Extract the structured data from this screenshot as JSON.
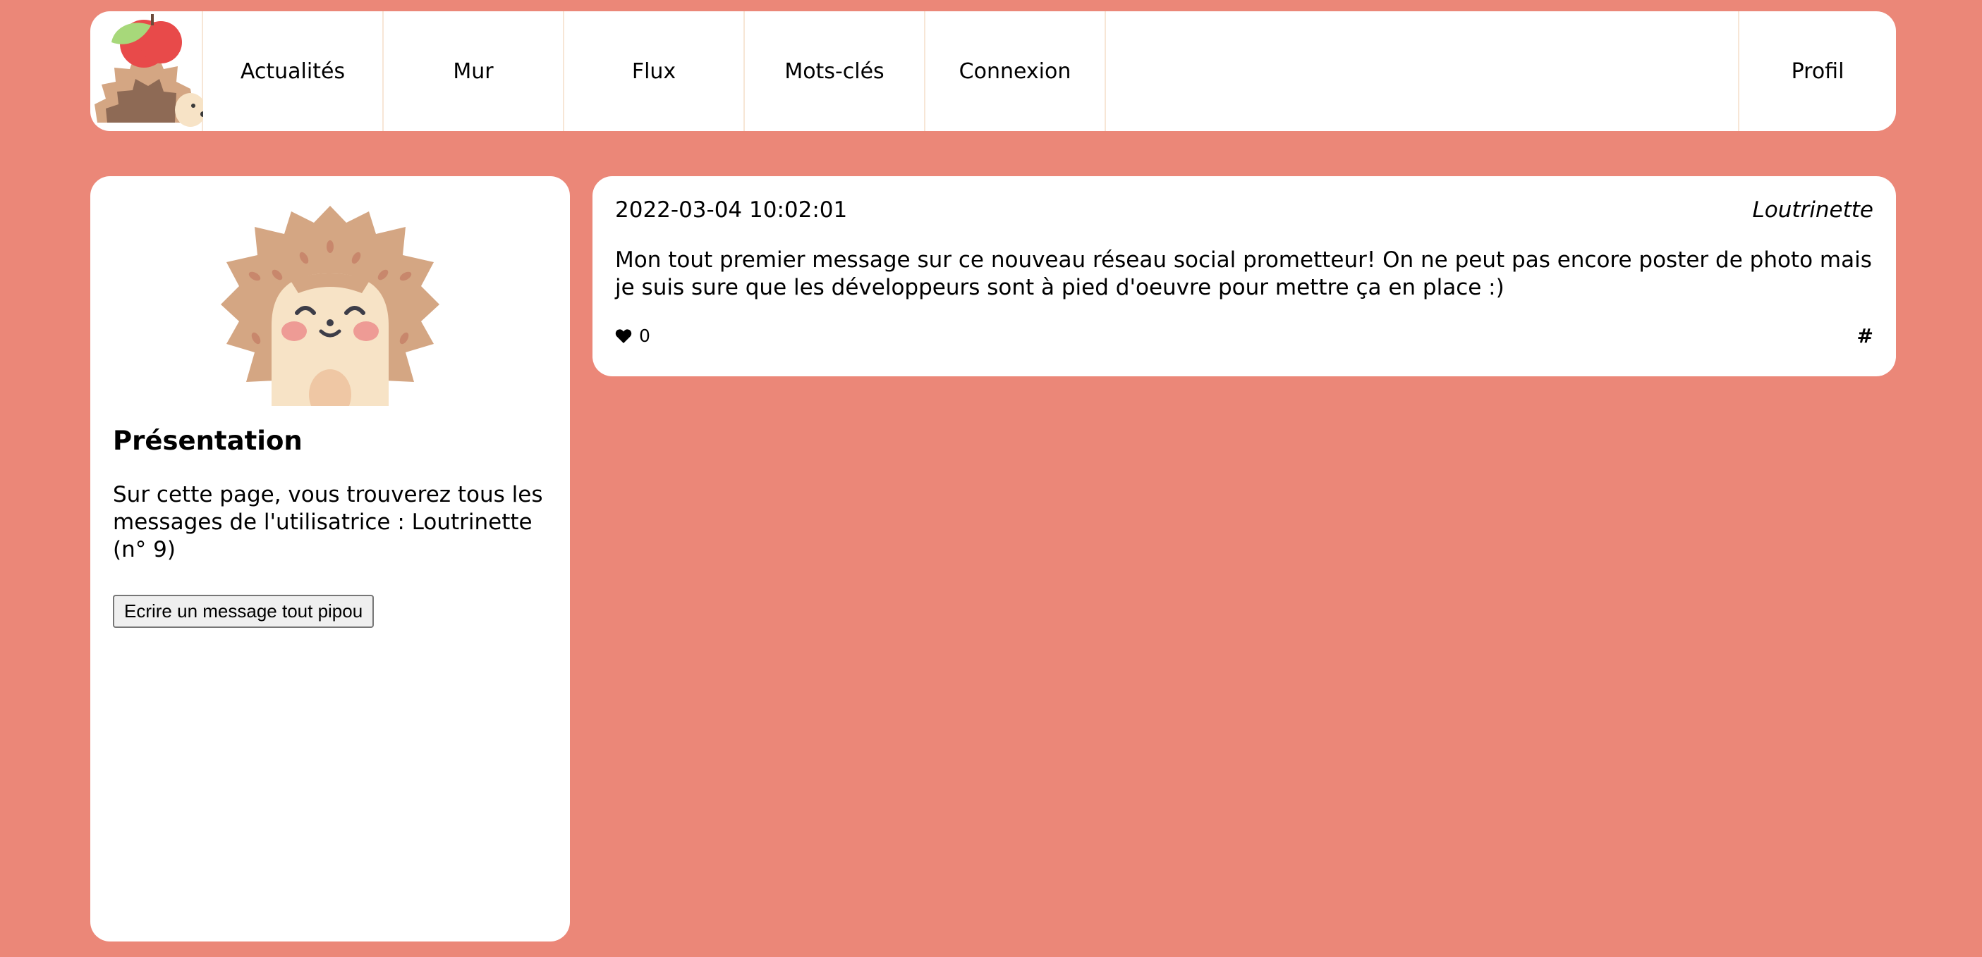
{
  "nav": {
    "items": [
      {
        "label": "Actualités"
      },
      {
        "label": "Mur"
      },
      {
        "label": "Flux"
      },
      {
        "label": "Mots-clés"
      },
      {
        "label": "Connexion"
      }
    ],
    "profile_label": "Profil"
  },
  "sidebar": {
    "title": "Présentation",
    "text": "Sur cette page, vous trouverez tous les messages de l'utilisatrice : Loutrinette (n° 9)",
    "button_label": "Ecrire un message tout pipou"
  },
  "post": {
    "date": "2022-03-04 10:02:01",
    "author": "Loutrinette",
    "content": "Mon tout premier message sur ce nouveau réseau social prometteur! On ne peut pas encore poster de photo mais je suis sure que les développeurs sont à pied d'oeuvre pour mettre ça en place :)",
    "likes": "0",
    "tag_symbol": "#"
  },
  "colors": {
    "background": "#eb8778",
    "card": "#ffffff",
    "hedgehog_spikes": "#d4a683",
    "hedgehog_face": "#f7e3c6",
    "cheeks": "#ee9b95",
    "apple": "#e84a4a"
  },
  "icons": {
    "logo": "hedgehog-with-apple-logo",
    "avatar": "hedgehog-avatar",
    "like": "heart-icon"
  }
}
